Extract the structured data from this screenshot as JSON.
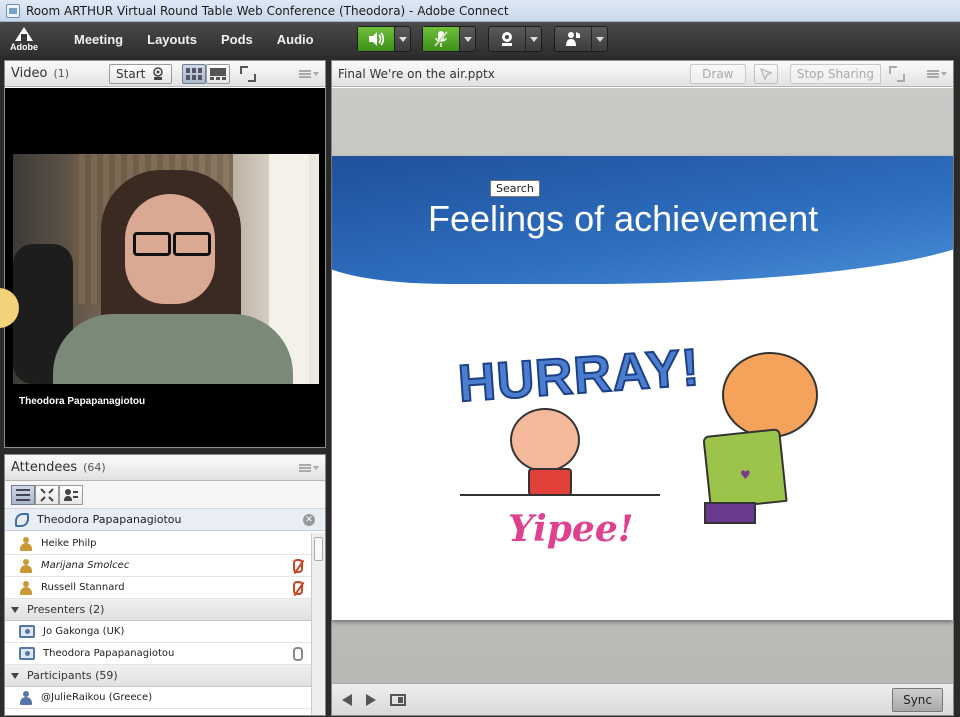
{
  "window": {
    "title": "Room ARTHUR Virtual Round Table Web Conference (Theodora) - Adobe Connect"
  },
  "menubar": {
    "logo_text": "Adobe",
    "items": [
      {
        "label": "Meeting"
      },
      {
        "label": "Layouts"
      },
      {
        "label": "Pods"
      },
      {
        "label": "Audio"
      }
    ],
    "tools": [
      {
        "icon": "speaker-icon",
        "state": "on"
      },
      {
        "icon": "microphone-icon",
        "state": "muted"
      },
      {
        "icon": "webcam-icon"
      },
      {
        "icon": "raise-hand-icon"
      }
    ]
  },
  "video_pod": {
    "title": "Video",
    "count": "(1)",
    "start_label": "Start",
    "participant_name": "Theodora Papapanagiotou"
  },
  "attendees_pod": {
    "title": "Attendees",
    "count": "(64)",
    "host": {
      "name": "Theodora Papapanagiotou"
    },
    "hosts": [
      {
        "name": "Heike Philp",
        "status": ""
      },
      {
        "name": "Marijana Smolcec",
        "status": "mic-muted",
        "italic": true
      },
      {
        "name": "Russell Stannard",
        "status": "mic-muted"
      }
    ],
    "presenters_group": "Presenters (2)",
    "presenters": [
      {
        "name": "Jo Gakonga (UK)",
        "status": ""
      },
      {
        "name": "Theodora Papapanagiotou",
        "status": "mic-on"
      }
    ],
    "participants_group": "Participants (59)",
    "participants": [
      {
        "name": "@JulieRaikou (Greece)"
      }
    ]
  },
  "share_pod": {
    "title": "Final We're on the air.pptx",
    "draw_label": "Draw",
    "stop_sharing_label": "Stop Sharing",
    "sync_label": "Sync",
    "slide": {
      "title": "Feelings of achievement",
      "tooltip": "Search",
      "hurray_text": "HURRAY!",
      "yipee_text": "Yipee!"
    }
  },
  "colors": {
    "menubar": "#3a3a3a",
    "accent_green": "#5aa82a",
    "slide_band": "#2e6fc0"
  }
}
